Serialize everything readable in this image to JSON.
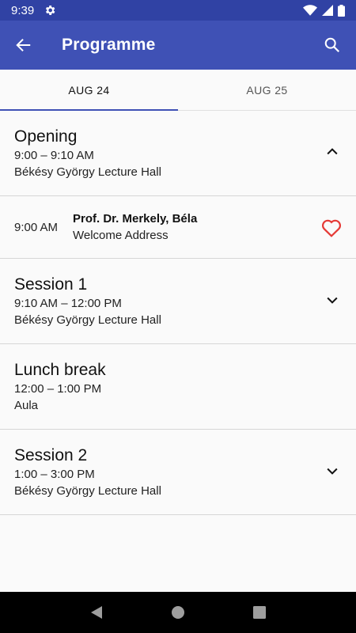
{
  "status": {
    "time": "9:39"
  },
  "app_bar": {
    "title": "Programme"
  },
  "tabs": [
    {
      "label": "AUG 24",
      "active": true
    },
    {
      "label": "AUG 25",
      "active": false
    }
  ],
  "items": {
    "opening": {
      "title": "Opening",
      "time": "9:00 – 9:10 AM",
      "room": "Békésy György Lecture Hall",
      "expanded": true
    },
    "talk": {
      "time": "9:00 AM",
      "speaker": "Prof. Dr. Merkely, Béla",
      "title": "Welcome Address"
    },
    "session1": {
      "title": "Session 1",
      "time": "9:10 AM – 12:00 PM",
      "room": "Békésy György Lecture Hall",
      "expanded": false
    },
    "lunch": {
      "title": "Lunch break",
      "time": "12:00 – 1:00 PM",
      "room": "Aula"
    },
    "session2": {
      "title": "Session 2",
      "time": "1:00 – 3:00 PM",
      "room": "Békésy György Lecture Hall",
      "expanded": false
    }
  },
  "colors": {
    "primary": "#3f51b5",
    "status_bar": "#3042a4",
    "favorite": "#e53935"
  },
  "icons": {
    "back": "arrow-left-icon",
    "search": "search-icon",
    "favorite": "heart-outline-icon"
  }
}
